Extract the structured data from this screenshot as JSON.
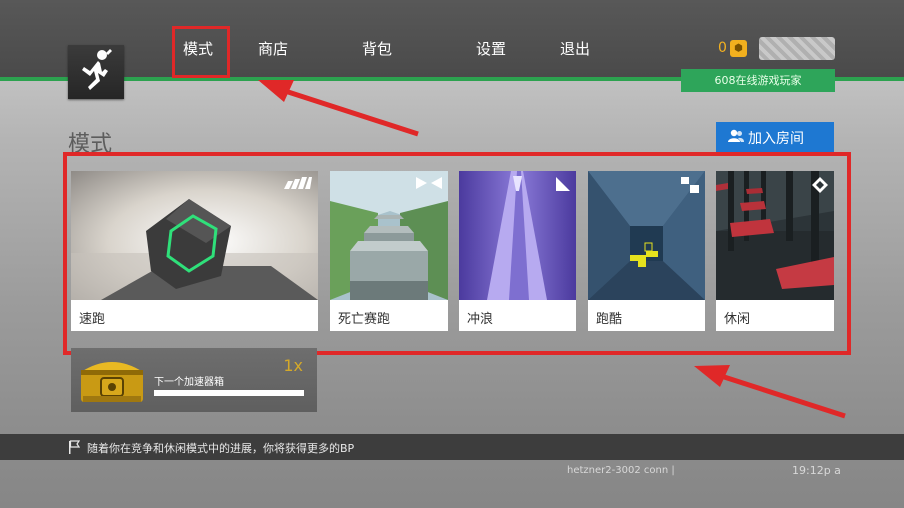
{
  "nav": {
    "items": [
      "模式",
      "商店",
      "背包",
      "设置",
      "退出"
    ]
  },
  "header": {
    "coins": "0",
    "online": "608在线游戏玩家"
  },
  "main": {
    "title": "模式",
    "join_button": "加入房间",
    "modes": [
      {
        "label": "速跑",
        "icon": "bars-icon"
      },
      {
        "label": "死亡赛跑",
        "icon": "bowtie-icon"
      },
      {
        "label": "冲浪",
        "icon": "triangle-icon"
      },
      {
        "label": "跑酷",
        "icon": "squares-icon"
      },
      {
        "label": "休闲",
        "icon": "diamond-icon"
      }
    ]
  },
  "booster": {
    "label": "下一个加速器箱",
    "count": "1x",
    "progress": 1.0
  },
  "footer": {
    "message": "随着你在竞争和休闲模式中的进展，你将获得更多的BP",
    "server": "hetzner2-3002 conn  |",
    "time": "19:12p a"
  },
  "colors": {
    "accent_green": "#2ca24f",
    "join_blue": "#1e78d2",
    "highlight_red": "#e02828",
    "coin_gold": "#f2b01e"
  }
}
